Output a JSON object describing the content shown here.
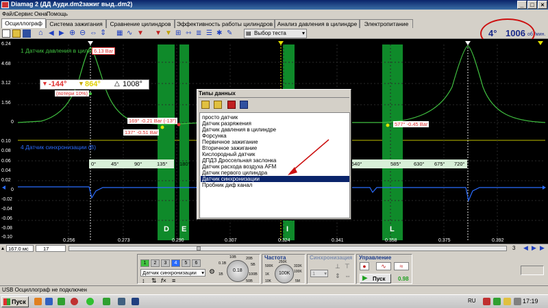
{
  "window": {
    "title": "Diamag 2 (ДД Ауди.dm2зажиг выд..dm2)"
  },
  "menu": [
    "Файл",
    "Сервис",
    "Окна",
    "Помощь"
  ],
  "tabs": [
    "Осциллограф",
    "Система зажигания",
    "Сравнение цилиндров",
    "Эффективность работы цилиндров",
    "Анализ давления в цилиндре",
    "Электропитание"
  ],
  "toolbar": {
    "test_select": "Выбор теста",
    "angle": "4°",
    "rpm": "1006",
    "rpm_unit": "об./мин."
  },
  "scope": {
    "ch1_label": "1 Датчик давления в цилиндре",
    "ch4_label": "4 Датчик синхронизации (B)",
    "ch1_y_ticks": [
      "6.24",
      "4.68",
      "3.12",
      "1.56",
      "0"
    ],
    "ch4_y_ticks": [
      "0.10",
      "0.08",
      "0.06",
      "0.04",
      "0.02",
      "0",
      "-0.02",
      "-0.04",
      "-0.06",
      "-0.08",
      "-0.10"
    ],
    "peak_marker": "6.13 Bar",
    "marker_red": "-144°",
    "marker_yellow": "864°",
    "marker_delta": "1008°",
    "loss_note": "(потери 10%)",
    "annot_1": "169° -0.21 Bar (-13°)",
    "annot_2": "137° -0.51 Bar",
    "annot_3": "577° -0.45 Bar",
    "degree_ticks_left": [
      "0°",
      "45°",
      "90°",
      "135°",
      "180°"
    ],
    "degree_ticks_right": [
      "540°",
      "585°",
      "630°",
      "675°",
      "720°"
    ],
    "zones": [
      "D",
      "E",
      "I",
      "L"
    ],
    "time_ticks": [
      "0.256",
      "0.273",
      "0.290",
      "0.307",
      "0.324",
      "0.341",
      "0.358",
      "0.375",
      "0.392"
    ]
  },
  "dialog": {
    "title": "Типы данных",
    "items": [
      "просто датчик",
      "Датчик разряжения",
      "Датчик давления в цилиндре",
      "Форсунка",
      "Первичное зажигание",
      "Вторичное зажигание",
      "Кислородный датчик",
      "ДПДЗ Дроссельная заслонка",
      "Датчик расхода воздуха AFM",
      "Датчик первого цилиндра",
      "Датчик синхронизации",
      "Пробник диф канал"
    ],
    "selected_index": 10
  },
  "bottom": {
    "time_base": "167.0 мс",
    "channel_count": "17",
    "page_num": "3",
    "channels": [
      "1",
      "2",
      "3",
      "4",
      "5",
      "6"
    ],
    "sensor_select": "Датчик синхронизации",
    "sensor_dial_value": "0.18",
    "freq_label": "Частота",
    "freq_value": "100K",
    "freq_ticks": [
      "250K",
      "500K",
      "333K",
      "100K",
      "1K",
      "10K",
      "5M"
    ],
    "sync_label": "Синхронизация",
    "sync_select": "1",
    "control_label": "Управление",
    "start_button": "Пуск",
    "control_value": "0.98",
    "dial_ticks": [
      "10B",
      "20B",
      "0.1B",
      "1B",
      "100B",
      "5B",
      "50B"
    ]
  },
  "status": {
    "text": "USB Осциллограф не подключен"
  },
  "taskbar": {
    "start": "Пуск",
    "lang": "RU",
    "time": "17:19"
  }
}
